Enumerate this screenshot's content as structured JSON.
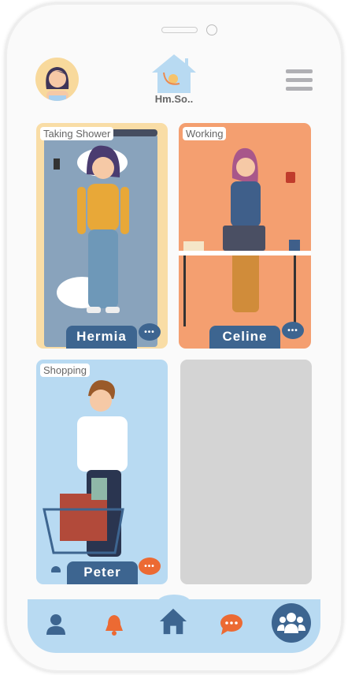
{
  "header": {
    "app_name": "Hm.So..",
    "avatar_icon": "user-avatar",
    "menu_icon": "hamburger-menu-icon"
  },
  "members": [
    {
      "name": "Hermia",
      "status": "Taking Shower",
      "background": "#f9dda6"
    },
    {
      "name": "Celine",
      "status": "Working",
      "background": "#f49f70"
    },
    {
      "name": "Peter",
      "status": "Shopping",
      "background": "#b8daf2"
    }
  ],
  "empty_slot_color": "#d4d4d4",
  "nav": {
    "items": [
      "profile-icon",
      "bell-icon",
      "home-icon",
      "chat-icon",
      "group-icon"
    ],
    "active": "group-icon"
  },
  "colors": {
    "primary": "#3d6590",
    "accent": "#ec6a33",
    "light": "#b8daf2"
  }
}
